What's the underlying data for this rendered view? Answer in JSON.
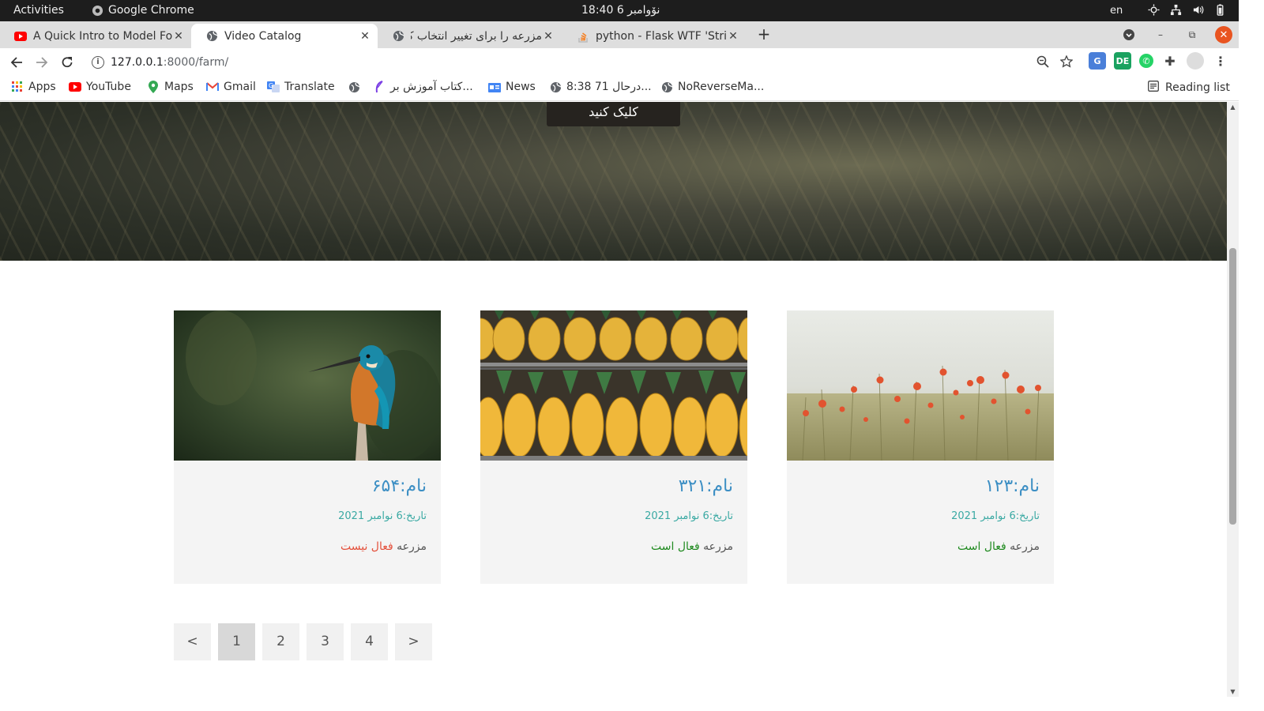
{
  "system_bar": {
    "activities": "Activities",
    "app_name": "Google Chrome",
    "clock": "نۆوامبر 6  18:40",
    "lang": "en"
  },
  "tabs": [
    {
      "label": "A Quick Intro to Model Fo",
      "icon": "youtube-icon",
      "active": false
    },
    {
      "label": "Video Catalog",
      "icon": "globe-icon",
      "active": true
    },
    {
      "label": "مزرعه را برای تغییر انتخاب ک",
      "icon": "globe-icon",
      "active": false
    },
    {
      "label": "python - Flask WTF 'String",
      "icon": "stackoverflow-icon",
      "active": false
    }
  ],
  "address_bar": {
    "host": "127.0.0.1",
    "path": ":8000/farm/"
  },
  "bookmarks": [
    {
      "label": "Apps",
      "icon": "apps-grid-icon"
    },
    {
      "label": "YouTube",
      "icon": "youtube-icon"
    },
    {
      "label": "Maps",
      "icon": "maps-pin-icon"
    },
    {
      "label": "Gmail",
      "icon": "gmail-icon"
    },
    {
      "label": "Translate",
      "icon": "translate-icon"
    },
    {
      "label": "",
      "icon": "globe-icon"
    },
    {
      "label": "کتاب آموزش بر...",
      "icon": "feather-icon"
    },
    {
      "label": "News",
      "icon": "news-icon"
    },
    {
      "label": "8:38 71 درحال...",
      "icon": "globe-icon"
    },
    {
      "label": "NoReverseMa...",
      "icon": "globe-icon"
    }
  ],
  "reading_list": "Reading list",
  "hero": {
    "button_label": "کلیک کنید"
  },
  "cards": [
    {
      "name": "نام:۱۲۳",
      "date": "تاریخ:6 نوامبر 2021",
      "status_prefix": "مزرعه",
      "status": "فعال است",
      "active": true,
      "image": "poppy-field"
    },
    {
      "name": "نام:۳۲۱",
      "date": "تاریخ:6 نوامبر 2021",
      "status_prefix": "مزرعه",
      "status": "فعال است",
      "active": true,
      "image": "pineapples"
    },
    {
      "name": "نام:۶۵۴",
      "date": "تاریخ:6 نوامبر 2021",
      "status_prefix": "مزرعه",
      "status": "فعال نیست",
      "active": false,
      "image": "kingfisher"
    }
  ],
  "pagination": {
    "prev": "<",
    "pages": [
      "1",
      "2",
      "3",
      "4"
    ],
    "current": "1",
    "next": ">"
  },
  "colors": {
    "active_status": "#1f8a1f",
    "inactive_status": "#e4503b",
    "card_title": "#3d8fc4",
    "card_date": "#3aa9a3"
  }
}
